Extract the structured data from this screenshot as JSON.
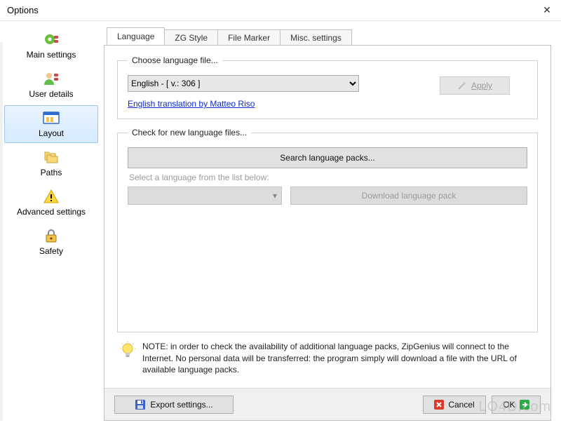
{
  "window": {
    "title": "Options"
  },
  "sidebar": {
    "items": [
      {
        "label": "Main settings"
      },
      {
        "label": "User details"
      },
      {
        "label": "Layout"
      },
      {
        "label": "Paths"
      },
      {
        "label": "Advanced settings"
      },
      {
        "label": "Safety"
      }
    ],
    "selected_index": 2
  },
  "tabs": {
    "items": [
      {
        "label": "Language"
      },
      {
        "label": "ZG Style"
      },
      {
        "label": "File Marker"
      },
      {
        "label": "Misc. settings"
      }
    ],
    "active_index": 0
  },
  "lang_group": {
    "legend": "Choose language file...",
    "selected": "English - [ v.: 306 ]",
    "credit_link": "English translation by Matteo Riso",
    "apply_label": "Apply"
  },
  "check_group": {
    "legend": "Check for new language files...",
    "search_label": "Search language packs...",
    "below_label": "Select a language from the list below:",
    "download_label": "Download language pack"
  },
  "note": {
    "text": "NOTE: in order to check the availability of additional language packs, ZipGenius will connect to the Internet. No personal data will be transferred: the program simply will download a file with the URL of available language packs."
  },
  "bottom": {
    "export_label": "Export settings...",
    "cancel_label": "Cancel",
    "ok_label": "OK"
  },
  "watermark": "LO4D.com"
}
